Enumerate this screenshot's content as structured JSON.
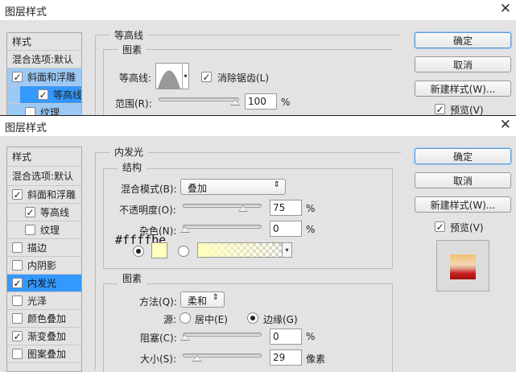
{
  "dialog1": {
    "title": "图层样式",
    "styles_header": "样式",
    "items": [
      {
        "label": "混合选项:默认"
      },
      {
        "label": "斜面和浮雕",
        "checked": true
      },
      {
        "label": "等高线",
        "checked": true
      },
      {
        "label": "纹理",
        "checked": false
      }
    ],
    "section_title": "等高线",
    "group_title": "图素",
    "contour_label": "等高线:",
    "anti_alias_label": "消除锯齿(L)",
    "range_label": "范围(R):",
    "range_value": "100",
    "range_unit": "%",
    "buttons": {
      "ok": "确定",
      "cancel": "取消",
      "new_style": "新建样式(W)...",
      "preview": "预览(V)"
    }
  },
  "dialog2": {
    "title": "图层样式",
    "styles_header": "样式",
    "items": [
      {
        "label": "混合选项:默认",
        "checked": null
      },
      {
        "label": "斜面和浮雕",
        "checked": true
      },
      {
        "label": "等高线",
        "checked": true
      },
      {
        "label": "纹理",
        "checked": false
      },
      {
        "label": "描边",
        "checked": false
      },
      {
        "label": "内阴影",
        "checked": false
      },
      {
        "label": "内发光",
        "checked": true
      },
      {
        "label": "光泽",
        "checked": false
      },
      {
        "label": "颜色叠加",
        "checked": false
      },
      {
        "label": "渐变叠加",
        "checked": true
      },
      {
        "label": "图案叠加",
        "checked": false
      }
    ],
    "section_title": "内发光",
    "structure": {
      "title": "结构",
      "blend_mode_label": "混合模式(B):",
      "blend_mode_value": "叠加",
      "opacity_label": "不透明度(O):",
      "opacity_value": "75",
      "opacity_unit": "%",
      "noise_label": "杂色(N):",
      "noise_value": "0",
      "noise_unit": "%",
      "color_annotation": "#ffffbe",
      "glow_color": "#ffffbe"
    },
    "elements": {
      "title": "图素",
      "method_label": "方法(Q):",
      "method_value": "柔和",
      "source_label": "源:",
      "source_center": "居中(E)",
      "source_edge": "边缘(G)",
      "choke_label": "阻塞(C):",
      "choke_value": "0",
      "choke_unit": "%",
      "size_label": "大小(S):",
      "size_value": "29",
      "size_unit": "像素"
    },
    "buttons": {
      "ok": "确定",
      "cancel": "取消",
      "new_style": "新建样式(W)...",
      "preview": "预览(V)"
    }
  }
}
